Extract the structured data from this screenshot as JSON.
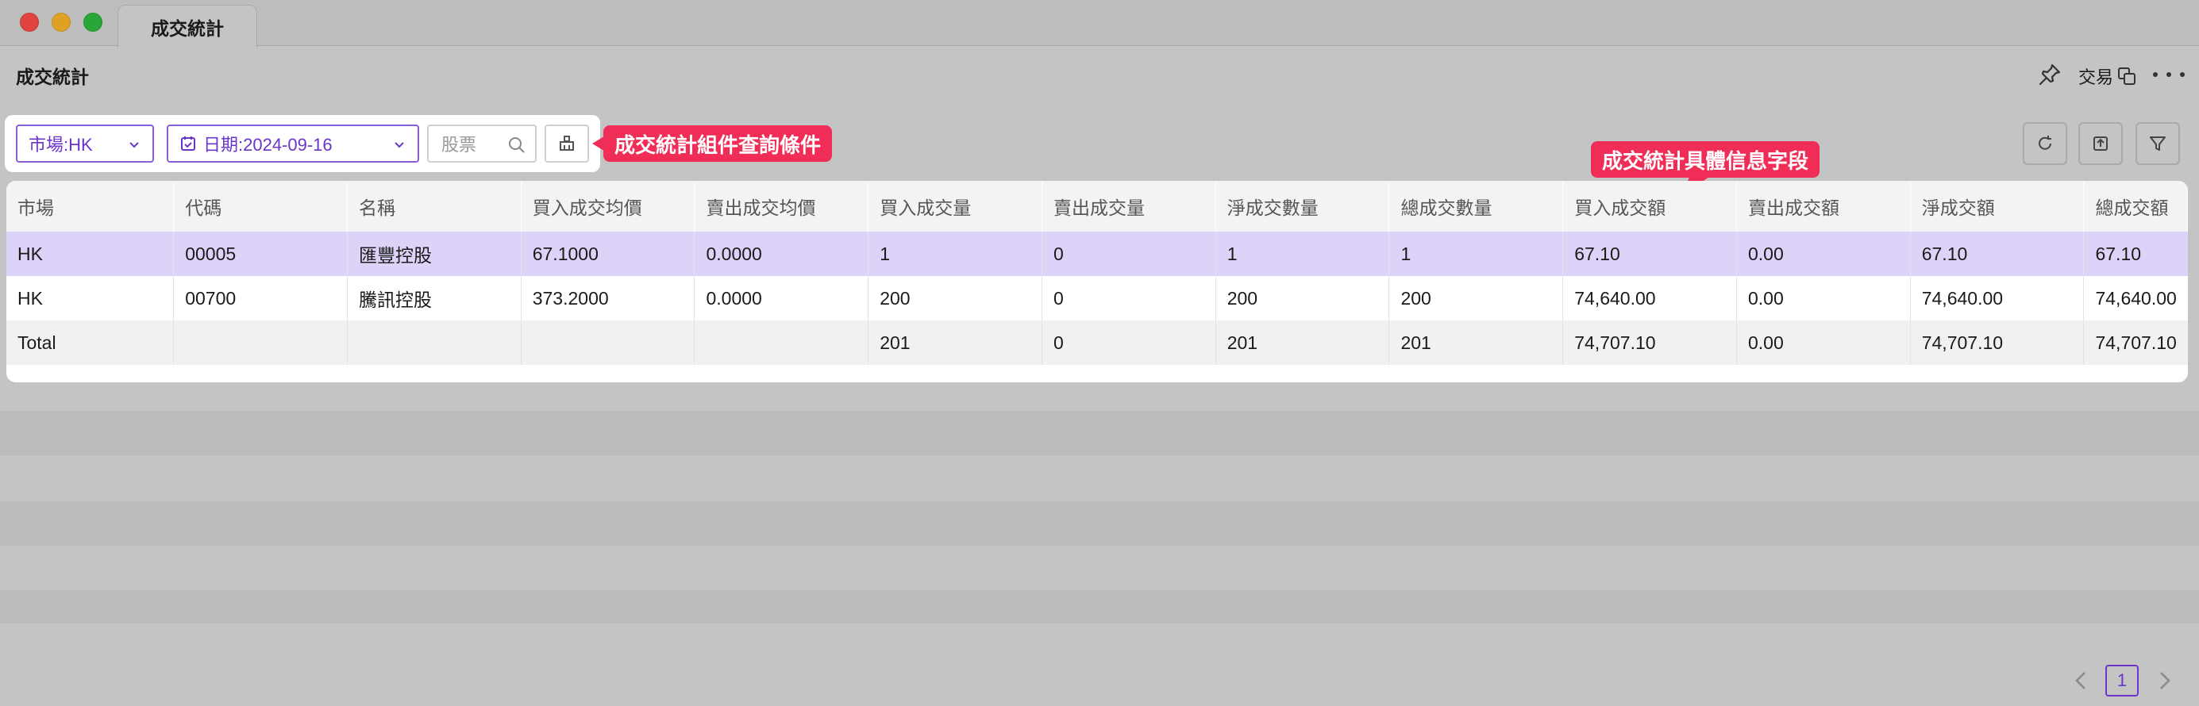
{
  "window": {
    "tab_title": "成交統計"
  },
  "header": {
    "title": "成交統計",
    "trade_label": "交易"
  },
  "filters": {
    "market_label": "市場:HK",
    "date_label": "日期:2024-09-16",
    "stock_placeholder": "股票"
  },
  "callouts": {
    "filters_note": "成交統計組件查詢條件",
    "fields_note": "成交統計具體信息字段"
  },
  "table": {
    "columns": [
      "市場",
      "代碼",
      "名稱",
      "買入成交均價",
      "賣出成交均價",
      "買入成交量",
      "賣出成交量",
      "淨成交數量",
      "總成交數量",
      "買入成交額",
      "賣出成交額",
      "淨成交額",
      "總成交額"
    ],
    "rows": [
      [
        "HK",
        "00005",
        "匯豐控股",
        "67.1000",
        "0.0000",
        "1",
        "0",
        "1",
        "1",
        "67.10",
        "0.00",
        "67.10",
        "67.10"
      ],
      [
        "HK",
        "00700",
        "騰訊控股",
        "373.2000",
        "0.0000",
        "200",
        "0",
        "200",
        "200",
        "74,640.00",
        "0.00",
        "74,640.00",
        "74,640.00"
      ]
    ],
    "total": [
      "Total",
      "",
      "",
      "",
      "",
      "201",
      "0",
      "201",
      "201",
      "74,707.10",
      "0.00",
      "74,707.10",
      "74,707.10"
    ]
  },
  "pagination": {
    "current_page": "1"
  },
  "colors": {
    "accent": "#6a35c8",
    "callout": "#ef2d56",
    "row_highlight": "#ddd3f8"
  }
}
